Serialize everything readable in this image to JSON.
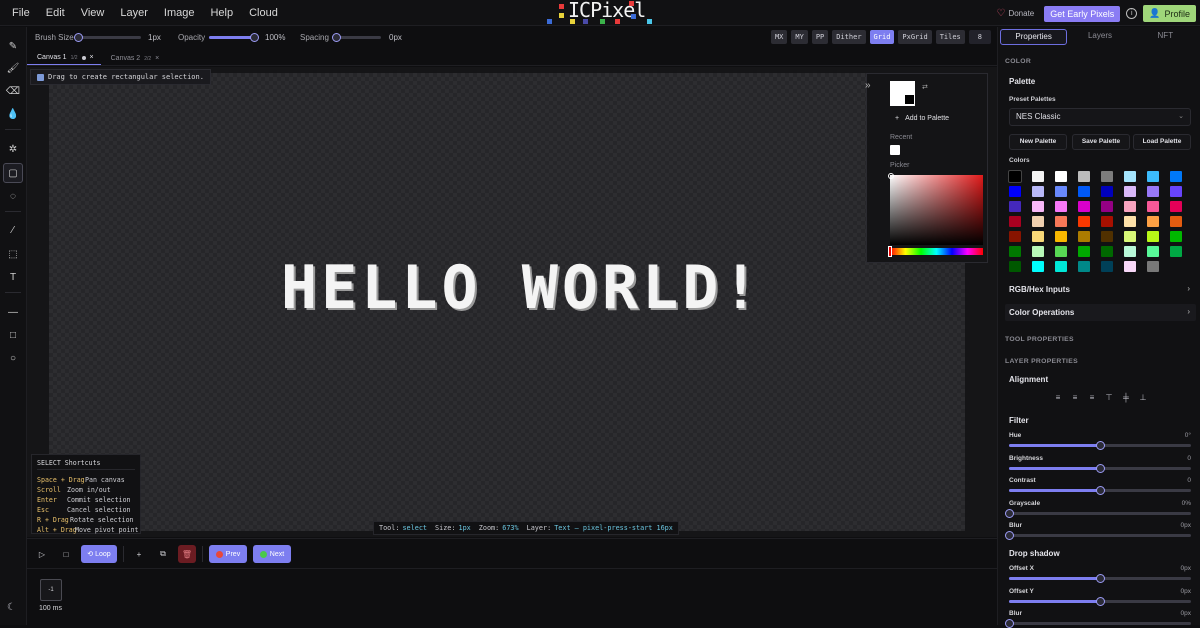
{
  "menu": [
    "File",
    "Edit",
    "View",
    "Layer",
    "Image",
    "Help",
    "Cloud"
  ],
  "logo": {
    "text": "ICPixel"
  },
  "header": {
    "donate": "Donate",
    "early_pixels": "Get Early Pixels",
    "profile": "Profile"
  },
  "options": {
    "brush_size_label": "Brush Size",
    "brush_size_value": "1px",
    "brush_size_level": 0.0,
    "opacity_label": "Opacity",
    "opacity_value": "100%",
    "opacity_level": 1.0,
    "spacing_label": "Spacing",
    "spacing_value": "0px",
    "spacing_level": 0.0,
    "toggles": [
      "MX",
      "MY",
      "PP",
      "Dither",
      "Grid",
      "PxGrid",
      "Tiles"
    ],
    "active_toggle": "Grid",
    "tile_count": "8"
  },
  "tabs": [
    {
      "label": "Canvas 1",
      "count": "1/2",
      "active": true
    },
    {
      "label": "Canvas 2",
      "count": "2/2",
      "active": false
    }
  ],
  "canvas": {
    "hint": "Drag to create rectangular selection.",
    "text": "HELLO WORLD!"
  },
  "palette_popup": {
    "swap": "⇄",
    "add_label": "Add to Palette",
    "recent_label": "Recent",
    "picker_label": "Picker",
    "front_color": "#ffffff",
    "back_color": "#000000"
  },
  "shortcuts": {
    "title": "SELECT Shortcuts",
    "rows": [
      {
        "key": "Space + Drag",
        "desc": "Pan canvas"
      },
      {
        "key": "Scroll",
        "desc": "Zoom in/out"
      },
      {
        "key": "Enter",
        "desc": "Commit selection"
      },
      {
        "key": "Esc",
        "desc": "Cancel selection"
      },
      {
        "key": "R + Drag",
        "desc": "Rotate selection"
      },
      {
        "key": "Alt + Drag",
        "desc": "Move pivot point"
      }
    ]
  },
  "status": {
    "tool_label": "Tool:",
    "tool": "select",
    "size_label": "Size:",
    "size": "1px",
    "zoom_label": "Zoom:",
    "zoom": "673%",
    "layer_label": "Layer:",
    "layer": "Text – pixel-press-start 16px"
  },
  "timeline": {
    "loop": "Loop",
    "prev": "Prev",
    "next": "Next",
    "frame_label": "-1",
    "frame_ms": "100 ms"
  },
  "right_panel": {
    "tabs": [
      "Properties",
      "Layers",
      "NFT"
    ],
    "active_tab": "Properties",
    "color_head": "COLOR",
    "palette_title": "Palette",
    "preset_label": "Preset Palettes",
    "preset_value": "NES Classic",
    "new_palette": "New Palette",
    "save_palette": "Save Palette",
    "load_palette": "Load Palette",
    "colors_label": "Colors",
    "colors": [
      "#000000",
      "#f4f4f4",
      "#ffffff",
      "#bcbcbc",
      "#7c7c7c",
      "#a4e4fc",
      "#3cbcfc",
      "#0078f8",
      "#0000fc",
      "#b8b8f8",
      "#6888fc",
      "#0058f8",
      "#0000bc",
      "#d8b8f8",
      "#9878f8",
      "#6844fc",
      "#4428bc",
      "#f8b8f8",
      "#f878f8",
      "#d800cc",
      "#940084",
      "#f8a4c0",
      "#f85898",
      "#e40058",
      "#a80020",
      "#f0d0b0",
      "#f87858",
      "#f83800",
      "#a81000",
      "#fce0a8",
      "#fca044",
      "#e45c10",
      "#881400",
      "#f8d878",
      "#f8b800",
      "#ac7c00",
      "#503000",
      "#d8f878",
      "#b8f818",
      "#00b800",
      "#007800",
      "#b8f8b8",
      "#58d854",
      "#00a800",
      "#006800",
      "#b8f8d8",
      "#58f898",
      "#00a844",
      "#005800",
      "#00fcfc",
      "#00e8d8",
      "#008888",
      "#004058",
      "#f8d8f8",
      "#787878"
    ],
    "rgb_hex": "RGB/Hex Inputs",
    "color_ops": "Color Operations",
    "tool_props_head": "TOOL PROPERTIES",
    "layer_props_head": "LAYER PROPERTIES",
    "alignment": "Alignment",
    "filter_title": "Filter",
    "filters": [
      {
        "label": "Hue",
        "value": "0°",
        "level": 0.5
      },
      {
        "label": "Brightness",
        "value": "0",
        "level": 0.5
      },
      {
        "label": "Contrast",
        "value": "0",
        "level": 0.5
      },
      {
        "label": "Grayscale",
        "value": "0%",
        "level": 0.0
      },
      {
        "label": "Blur",
        "value": "0px",
        "level": 0.0
      }
    ],
    "drop_shadow_title": "Drop shadow",
    "shadow": [
      {
        "label": "Offset X",
        "value": "0px",
        "level": 0.5
      },
      {
        "label": "Offset Y",
        "value": "0px",
        "level": 0.5
      },
      {
        "label": "Blur",
        "value": "0px",
        "level": 0.0
      }
    ]
  }
}
